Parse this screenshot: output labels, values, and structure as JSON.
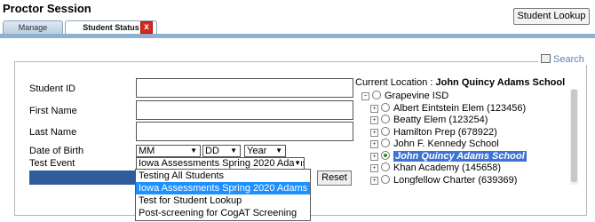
{
  "header": {
    "title": "Proctor Session",
    "student_lookup_button": "Student Lookup"
  },
  "tabs": [
    {
      "label": "Manage"
    },
    {
      "label": "Student Status",
      "close": "x"
    }
  ],
  "search": {
    "label": "Search"
  },
  "form": {
    "student_id_label": "Student ID",
    "first_name_label": "First Name",
    "last_name_label": "Last Name",
    "dob_label": "Date of Birth",
    "dob_month": "MM",
    "dob_day": "DD",
    "dob_year": "Year",
    "test_event_label": "Test Event",
    "test_event_value": "Iowa Assessments Spring 2020 Adams",
    "reset_button": "Reset"
  },
  "test_event_options": [
    "Testing All Students",
    "Iowa Assessments Spring 2020 Adams",
    "Test for Student Lookup",
    "Post-screening for CogAT Screening"
  ],
  "selected_option_index": 1,
  "location": {
    "prefix": "Current Location :",
    "name": "John Quincy Adams School",
    "tree": [
      {
        "label": "Grapevine ISD",
        "level": 0,
        "selected": false
      },
      {
        "label": "Albert Eintstein Elem (123456)",
        "level": 1,
        "selected": false
      },
      {
        "label": "Beatty Elem (123254)",
        "level": 1,
        "selected": false
      },
      {
        "label": "Hamilton Prep (678922)",
        "level": 1,
        "selected": false
      },
      {
        "label": "John F. Kennedy School",
        "level": 1,
        "selected": false
      },
      {
        "label": "John Quincy Adams School",
        "level": 1,
        "selected": true
      },
      {
        "label": "Khan Academy (145658)",
        "level": 1,
        "selected": false
      },
      {
        "label": "Longfellow Charter (639369)",
        "level": 1,
        "selected": false
      }
    ]
  },
  "colors": {
    "tabline": "#8fb0d0",
    "dropdown_highlight": "#1e90ff",
    "tree_selected": "#3b74d3",
    "action_bar": "#2f5c9a"
  }
}
